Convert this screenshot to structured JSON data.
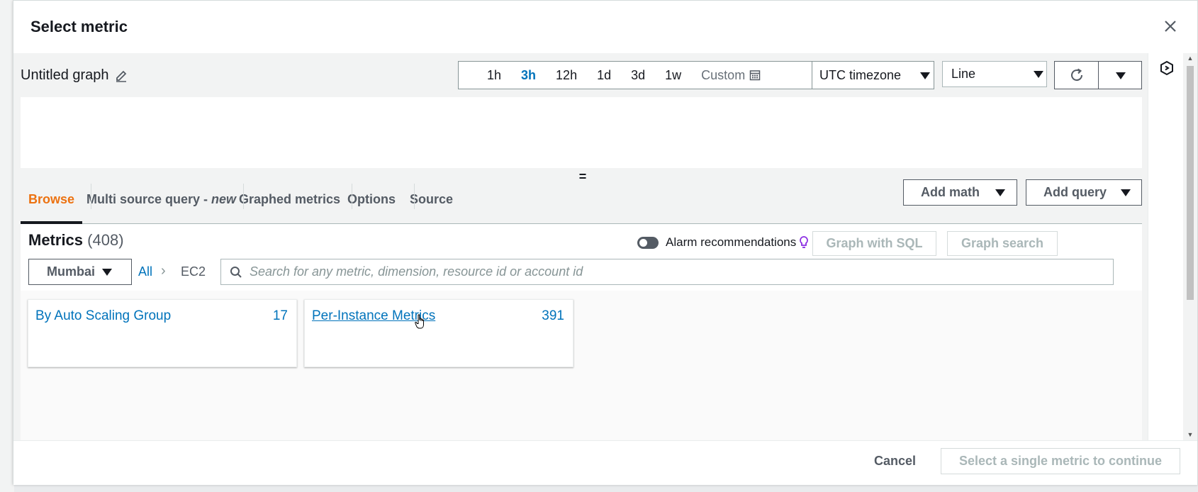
{
  "dialog": {
    "title": "Select metric",
    "close_icon": "close-icon"
  },
  "graph": {
    "title": "Untitled graph",
    "edit_icon": "pencil-icon"
  },
  "time_ranges": [
    "1h",
    "3h",
    "12h",
    "1d",
    "3d",
    "1w"
  ],
  "active_range": "3h",
  "custom_label": "Custom",
  "timezone": "UTC timezone",
  "chart_type": "Line",
  "tabs": {
    "browse": "Browse",
    "multi_source": "Multi source query -",
    "multi_source_new": "new",
    "graphed": "Graphed metrics",
    "options": "Options",
    "source": "Source"
  },
  "buttons": {
    "add_math": "Add math",
    "add_query": "Add query",
    "graph_sql": "Graph with SQL",
    "graph_search": "Graph search"
  },
  "metrics": {
    "title": "Metrics",
    "count": "(408)"
  },
  "alarm_recommendations": {
    "label": "Alarm recommendations",
    "enabled": false
  },
  "region": "Mumbai",
  "breadcrumb": {
    "all": "All",
    "current": "EC2"
  },
  "search": {
    "placeholder": "Search for any metric, dimension, resource id or account id",
    "value": ""
  },
  "cards": [
    {
      "label": "By Auto Scaling Group",
      "count": "17"
    },
    {
      "label": "Per-Instance Metrics",
      "count": "391"
    }
  ],
  "footer": {
    "cancel": "Cancel",
    "continue": "Select a single metric to continue"
  },
  "colors": {
    "accent": "#0073bb",
    "active_tab": "#ec7211",
    "text": "#16191f",
    "muted": "#545b64"
  }
}
